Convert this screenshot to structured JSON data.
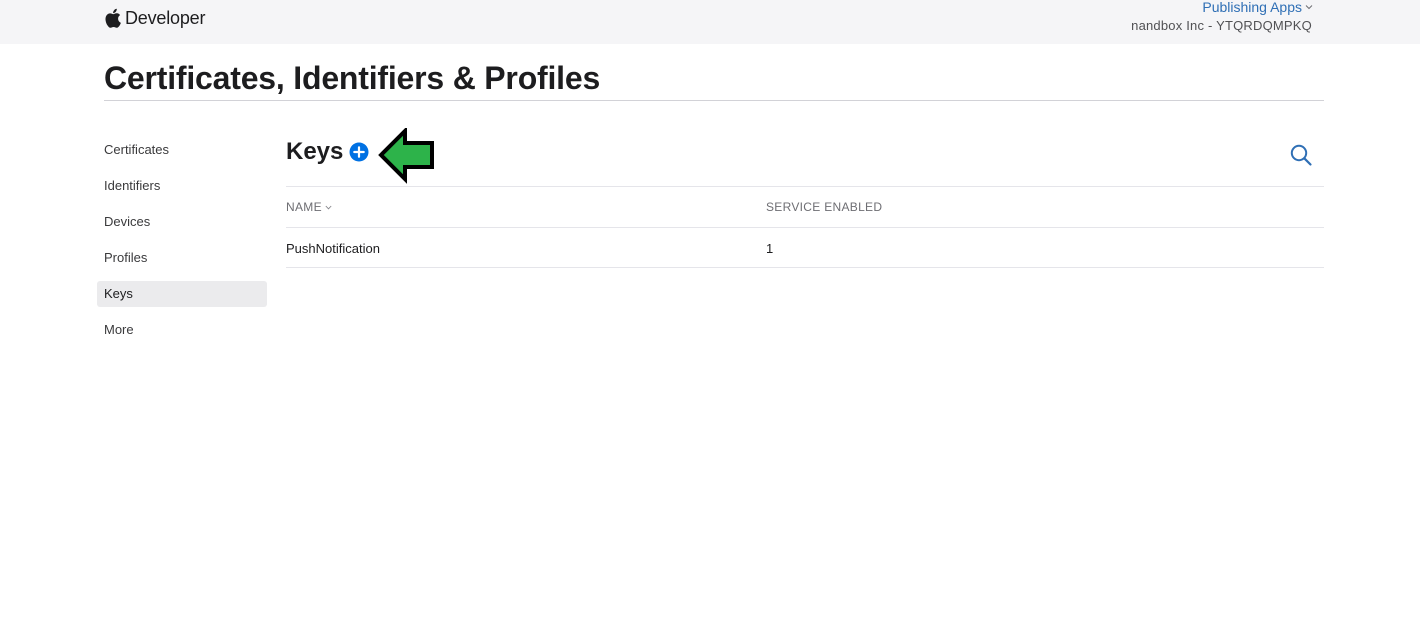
{
  "header": {
    "brand": "Developer",
    "team_menu_label": "Publishing Apps",
    "team_name": "nandbox Inc - YTQRDQMPKQ"
  },
  "page": {
    "title": "Certificates, Identifiers & Profiles"
  },
  "sidebar": {
    "items": [
      {
        "label": "Certificates"
      },
      {
        "label": "Identifiers"
      },
      {
        "label": "Devices"
      },
      {
        "label": "Profiles"
      },
      {
        "label": "Keys",
        "active": true
      },
      {
        "label": "More"
      }
    ]
  },
  "keys": {
    "title": "Keys",
    "columns": [
      "NAME",
      "SERVICE ENABLED"
    ],
    "rows": [
      {
        "name": "PushNotification",
        "services": "1"
      }
    ]
  },
  "colors": {
    "accent": "#0071e3",
    "link": "#2f6fb5",
    "annotation_arrow": "#2db34a"
  }
}
